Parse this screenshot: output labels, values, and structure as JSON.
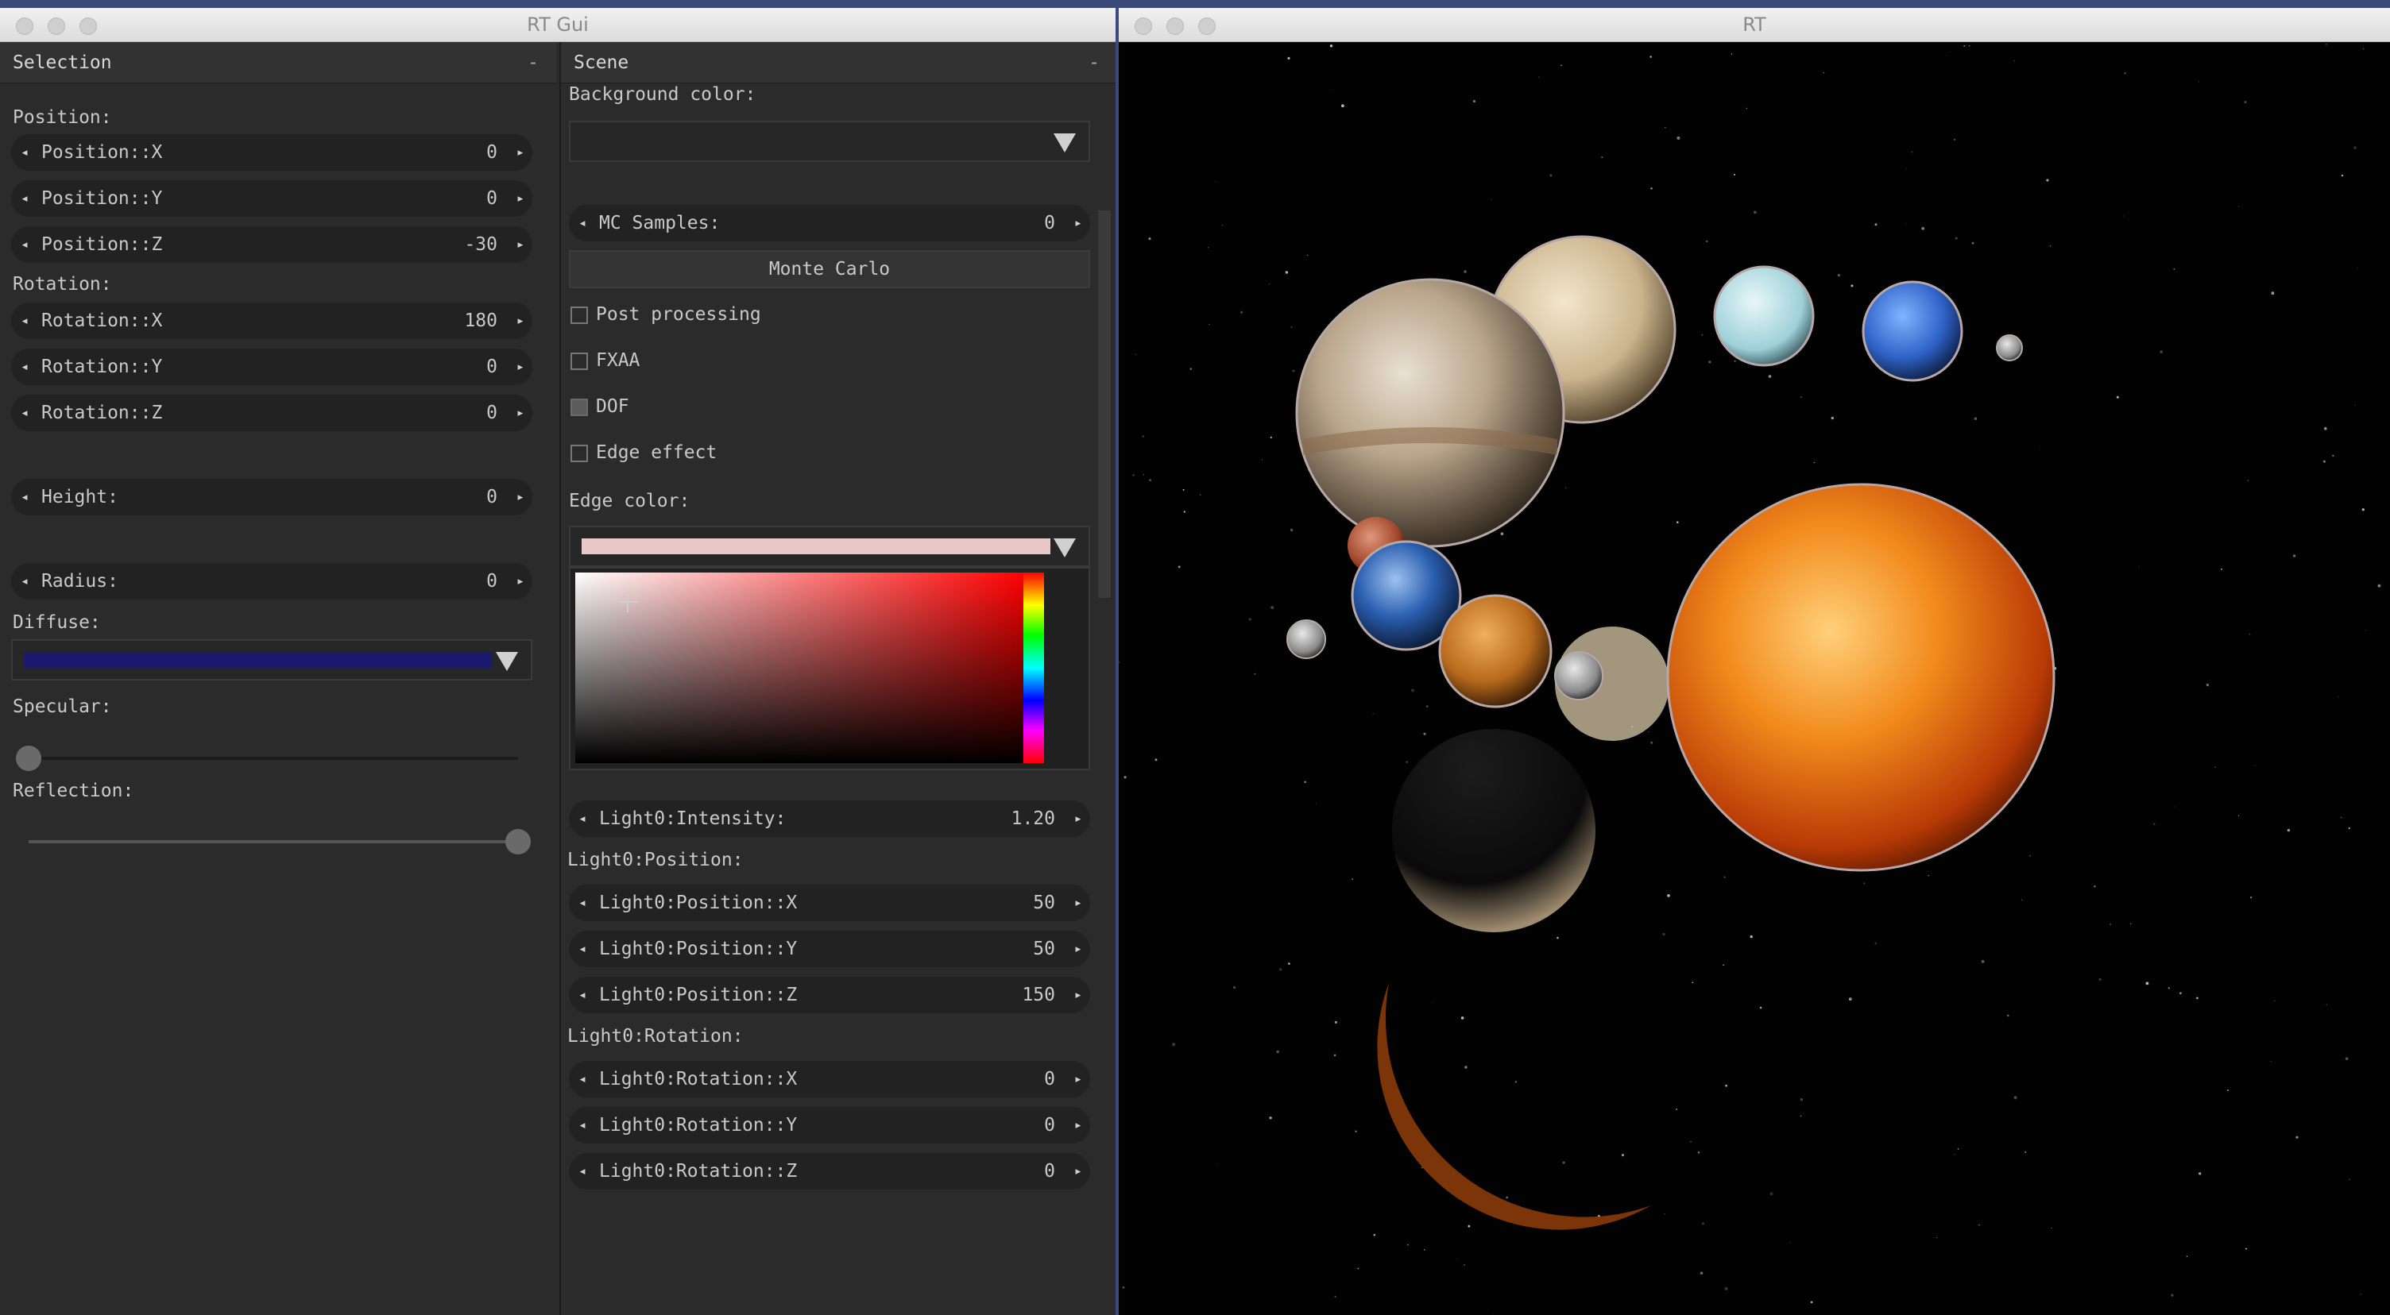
{
  "gui_window": {
    "title": "RT Gui"
  },
  "rt_window": {
    "title": "RT"
  },
  "selection": {
    "header": "Selection",
    "minimize": "-",
    "position_label": "Position:",
    "position_x": {
      "label": "Position::X",
      "value": "0"
    },
    "position_y": {
      "label": "Position::Y",
      "value": "0"
    },
    "position_z": {
      "label": "Position::Z",
      "value": "-30"
    },
    "rotation_label": "Rotation:",
    "rotation_x": {
      "label": "Rotation::X",
      "value": "180"
    },
    "rotation_y": {
      "label": "Rotation::Y",
      "value": "0"
    },
    "rotation_z": {
      "label": "Rotation::Z",
      "value": "0"
    },
    "height": {
      "label": "Height:",
      "value": "0"
    },
    "radius": {
      "label": "Radius:",
      "value": "0"
    },
    "diffuse_label": "Diffuse:",
    "diffuse_color": "#1b1a6e",
    "specular_label": "Specular:",
    "specular_value": 0.0,
    "reflection_label": "Reflection:",
    "reflection_value": 1.0
  },
  "scene": {
    "header": "Scene",
    "minimize": "-",
    "background_color_label": "Background color:",
    "mc_samples": {
      "label": "MC Samples:",
      "value": "0"
    },
    "monte_carlo_button": "Monte Carlo",
    "post_processing": {
      "label": "Post processing",
      "checked": false
    },
    "fxaa": {
      "label": "FXAA",
      "checked": false
    },
    "dof": {
      "label": "DOF",
      "checked": true
    },
    "edge_effect": {
      "label": "Edge effect",
      "checked": false
    },
    "edge_color_label": "Edge color:",
    "edge_color": "#e8c8c8",
    "light_intensity": {
      "label": "Light0:Intensity:",
      "value": "1.20"
    },
    "light_position_label": "Light0:Position:",
    "light_position_x": {
      "label": "Light0:Position::X",
      "value": "50"
    },
    "light_position_y": {
      "label": "Light0:Position::Y",
      "value": "50"
    },
    "light_position_z": {
      "label": "Light0:Position::Z",
      "value": "150"
    },
    "light_rotation_label": "Light0:Rotation:",
    "light_rotation_x": {
      "label": "Light0:Rotation::X",
      "value": "0"
    },
    "light_rotation_y": {
      "label": "Light0:Rotation::Y",
      "value": "0"
    },
    "light_rotation_z": {
      "label": "Light0:Rotation::Z",
      "value": "0"
    }
  },
  "icons": {
    "left_arrow": "◂",
    "right_arrow": "▸"
  }
}
